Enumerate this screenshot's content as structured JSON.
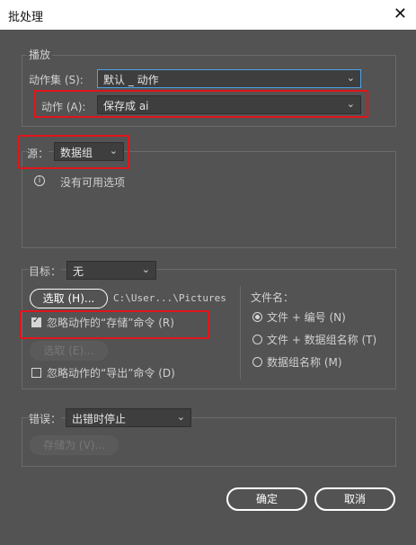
{
  "window": {
    "title": "批处理",
    "close_glyph": "✕"
  },
  "play": {
    "legend": "播放",
    "set_label": "动作集 (S):",
    "set_value": "默认 _ 动作",
    "action_label": "动作 (A):",
    "action_value": "保存成 ai"
  },
  "source": {
    "label": "源：",
    "value": "数据组",
    "no_options_text": "没有可用选项"
  },
  "target": {
    "label": "目标：",
    "value": "无",
    "choose_button": "选取 (H)...",
    "path": "C:\\User...\\Pictures",
    "override_save_label": "忽略动作的“存储”命令 (R)",
    "override_save_checked": true,
    "choose_disabled_button": "选取 (E)...",
    "override_export_label": "忽略动作的“导出”命令 (D)",
    "override_export_checked": false,
    "file_name_label": "文件名：",
    "naming_options": [
      {
        "label": "文件 + 编号 (N)",
        "selected": true
      },
      {
        "label": "文件 + 数据组名称 (T)",
        "selected": false
      },
      {
        "label": "数据组名称 (M)",
        "selected": false
      }
    ]
  },
  "errors": {
    "label": "错误：",
    "value": "出错时停止",
    "save_as_button": "存储为 (V)..."
  },
  "footer": {
    "ok_button": "确定",
    "cancel_button": "取消"
  },
  "colors": {
    "background": "#535353",
    "highlight": "#e1141b",
    "focus": "#4da3e6"
  }
}
